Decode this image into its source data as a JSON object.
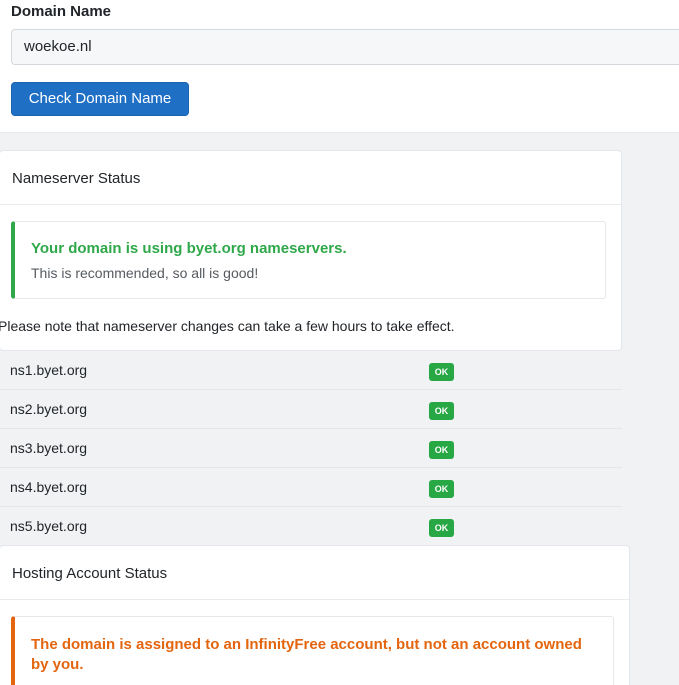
{
  "domain_form": {
    "label": "Domain Name",
    "input_value": "woekoe.nl",
    "button_label": "Check Domain Name"
  },
  "nameserver_status": {
    "title": "Nameserver Status",
    "alert_title": "Your domain is using byet.org nameservers.",
    "alert_text": "This is recommended, so all is good!",
    "note": "Please note that nameserver changes can take a few hours to take effect.",
    "nameservers": [
      {
        "name": "ns1.byet.org",
        "status": "OK"
      },
      {
        "name": "ns2.byet.org",
        "status": "OK"
      },
      {
        "name": "ns3.byet.org",
        "status": "OK"
      },
      {
        "name": "ns4.byet.org",
        "status": "OK"
      },
      {
        "name": "ns5.byet.org",
        "status": "OK"
      }
    ]
  },
  "hosting_status": {
    "title": "Hosting Account Status",
    "alert_title": "The domain is assigned to an InfinityFree account, but not an account owned by you."
  },
  "colors": {
    "primary": "#1f6fc5",
    "success": "#2fa84a",
    "warning": "#e3650f"
  }
}
